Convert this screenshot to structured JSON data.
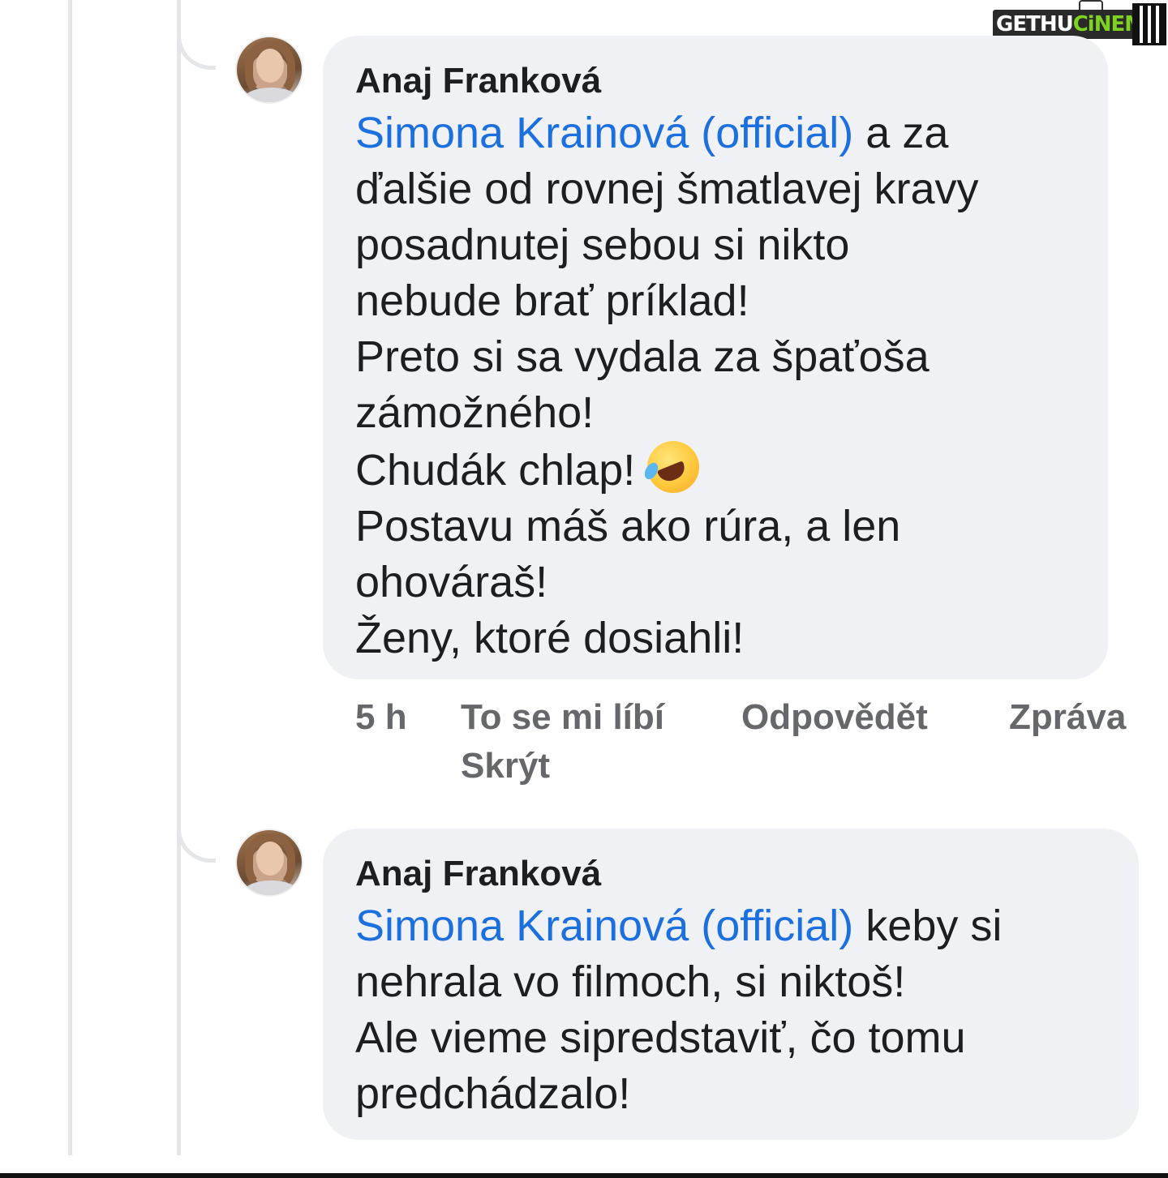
{
  "watermark": {
    "part1": "GETHU",
    "part2": "CiNEMA"
  },
  "comments": [
    {
      "author": "Anaj Franková",
      "mention": "Simona Krainová (official)",
      "lines": [
        " a za",
        "ďalšie od rovnej šmatlavej kravy",
        "posadnutej sebou si nikto",
        "nebude brať príklad!",
        "Preto si sa vydala za špaťoša",
        "zámožného!",
        "Chudák chlap! ",
        "Postavu máš ako rúra, a len",
        "ohováraš!",
        "Ženy, ktoré dosiahli!"
      ],
      "emoji": "rolling-on-floor-laughing-emoji",
      "actions": {
        "time": "5 h",
        "like": "To se mi líbí",
        "reply": "Odpovědět",
        "message": "Zpráva",
        "hide": "Skrýt"
      }
    },
    {
      "author": "Anaj Franková",
      "mention": "Simona Krainová (official)",
      "lines": [
        " keby si",
        "nehrala vo filmoch, si niktoš!",
        "Ale vieme sipredstaviť, čo tomu",
        "predchádzalo!"
      ]
    }
  ]
}
